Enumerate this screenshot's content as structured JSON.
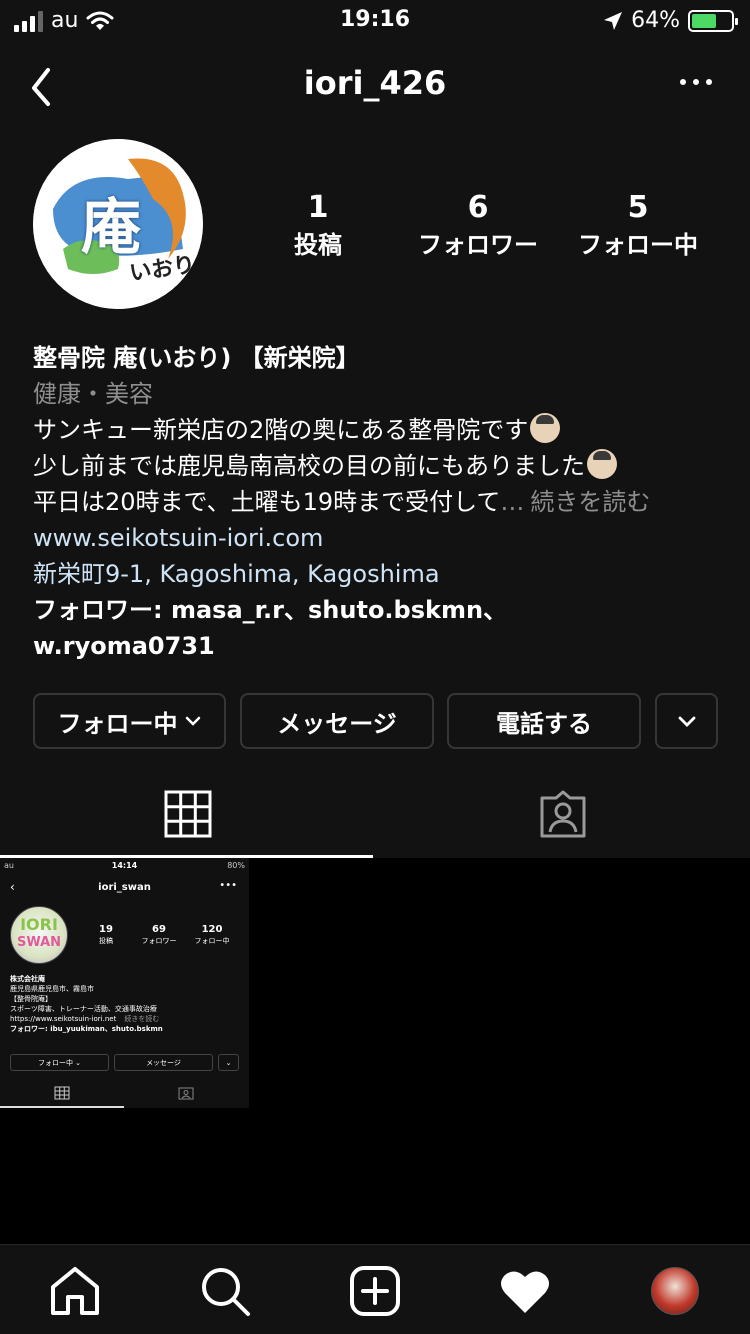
{
  "status": {
    "carrier": "au",
    "time": "19:16",
    "battery": "64%",
    "battery_level": 0.64,
    "battery_color": "#4cd964"
  },
  "header": {
    "title": "iori_426",
    "back_icon": "chevron-left-icon",
    "more_icon": "more-horizontal-icon"
  },
  "profile": {
    "avatar_text_main": "庵",
    "avatar_text_sub": "いおり",
    "stats": [
      {
        "value": "1",
        "label": "投稿"
      },
      {
        "value": "6",
        "label": "フォロワー"
      },
      {
        "value": "5",
        "label": "フォロー中"
      }
    ]
  },
  "bio": {
    "name": "整骨院 庵(いおり) 【新栄院】",
    "category": "健康・美容",
    "line1": "サンキュー新栄店の2階の奥にある整骨院です",
    "line2": "少し前までは鹿児島南高校の目の前にもありました",
    "line3": "平日は20時まで、土曜も19時まで受付して",
    "more_dots": "…",
    "more": "続きを読む",
    "website": "www.seikotsuin-iori.com",
    "address": "新栄町9-1, Kagoshima, Kagoshima",
    "followed_by_prefix": "フォロワー: ",
    "followed_by_1": "masa_r.r",
    "sep1": "、",
    "followed_by_2": "shuto.bskmn",
    "sep2": "、",
    "followed_by_3": "w.ryoma0731"
  },
  "actions": {
    "following": "フォロー中",
    "message": "メッセージ",
    "call": "電話する"
  },
  "tabs": [
    {
      "name": "grid",
      "icon": "grid-icon",
      "active": true
    },
    {
      "name": "tagged",
      "icon": "tagged-person-icon",
      "active": false
    }
  ],
  "post": {
    "status_left": "au",
    "status_time": "14:14",
    "status_right": "80%",
    "title": "iori_swan",
    "avatar_text1": "IORI",
    "avatar_text2": "SWAN",
    "stats": [
      {
        "value": "19",
        "label": "投稿"
      },
      {
        "value": "69",
        "label": "フォロワー"
      },
      {
        "value": "120",
        "label": "フォロー中"
      }
    ],
    "bio_lines": [
      "株式会社庵",
      "鹿児島県鹿児島市、霧島市",
      "【整骨院庵】",
      "スポーツ障害、トレーナー活動、交通事故治療",
      "https://www.seikotsuin-iori.net"
    ],
    "bio_more": "続きを読む",
    "followers_line": "フォロワー: ibu_yuukiman、shuto.bskmn",
    "btn_following": "フォロー中",
    "btn_message": "メッセージ"
  },
  "bottom_nav": [
    {
      "name": "home",
      "icon": "home-icon"
    },
    {
      "name": "search",
      "icon": "search-icon"
    },
    {
      "name": "new-post",
      "icon": "plus-square-icon"
    },
    {
      "name": "activity",
      "icon": "heart-icon"
    },
    {
      "name": "profile",
      "icon": "profile-avatar"
    }
  ]
}
